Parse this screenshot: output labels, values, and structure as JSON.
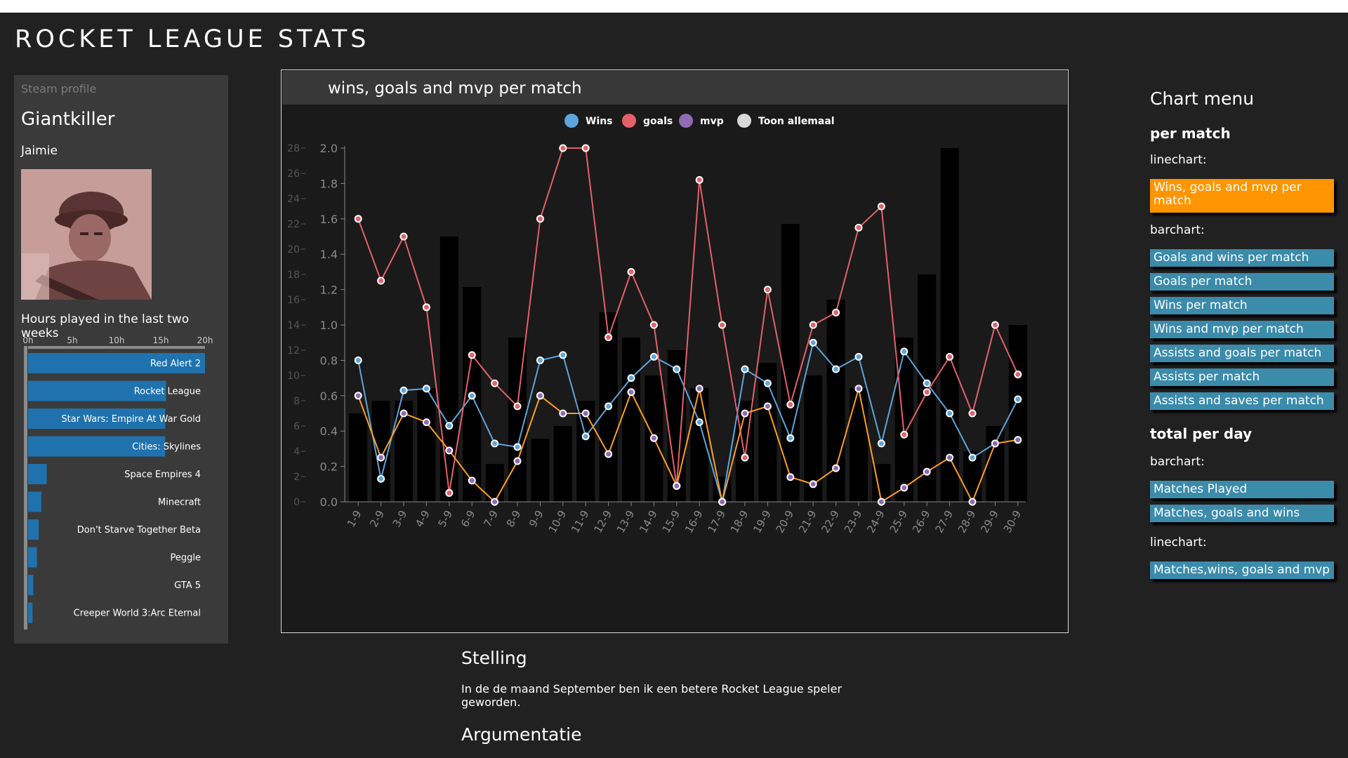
{
  "app": {
    "title": "ROCKET LEAGUE STATS"
  },
  "profile": {
    "section_label": "Steam profile",
    "username": "Giantkiller",
    "real_name": "Jaimie",
    "hours_title": "Hours played in the last two weeks",
    "hours_ticks": [
      "0h",
      "5h",
      "10h",
      "15h",
      "20h"
    ],
    "hours_max": 20,
    "games": [
      {
        "name": "Red Alert 2",
        "hours": 20
      },
      {
        "name": "Rocket League",
        "hours": 15.6
      },
      {
        "name": "Star Wars: Empire At War Gold",
        "hours": 15.5
      },
      {
        "name": "Cities: Skylines",
        "hours": 15.5
      },
      {
        "name": "Space Empires 4",
        "hours": 2.1
      },
      {
        "name": "Minecraft",
        "hours": 1.5
      },
      {
        "name": "Don't Starve Together Beta",
        "hours": 1.2
      },
      {
        "name": "Peggle",
        "hours": 1.0
      },
      {
        "name": "GTA 5",
        "hours": 0.6
      },
      {
        "name": "Creeper World 3:Arc Eternal",
        "hours": 0.5
      }
    ]
  },
  "main_chart": {
    "title": "wins, goals and mvp per match",
    "legend": [
      {
        "label": "Wins",
        "color": "#5da5da"
      },
      {
        "label": "goals",
        "color": "#e5606a"
      },
      {
        "label": "mvp",
        "color": "#8e6bb3"
      },
      {
        "label": "Toon allemaal",
        "color": "#d8d8d8"
      }
    ]
  },
  "chart_data": {
    "type": "line",
    "title": "wins, goals and mvp per match",
    "x": [
      "1-9",
      "2-9",
      "3-9",
      "4-9",
      "5-9",
      "6-9",
      "7-9",
      "8-9",
      "9-9",
      "10-9",
      "11-9",
      "12-9",
      "13-9",
      "14-9",
      "15-9",
      "16-9",
      "17-9",
      "18-9",
      "19-9",
      "20-9",
      "21-9",
      "22-9",
      "23-9",
      "24-9",
      "25-9",
      "26-9",
      "27-9",
      "28-9",
      "29-9",
      "30-9"
    ],
    "y_left": {
      "ticks": [
        0,
        2,
        4,
        6,
        8,
        10,
        12,
        14,
        16,
        18,
        20,
        22,
        24,
        26,
        28
      ],
      "ylim": [
        0,
        28
      ]
    },
    "y_right": {
      "ticks": [
        "0.0",
        "0.2",
        "0.4",
        "0.6",
        "0.8",
        "1.0",
        "1.2",
        "1.4",
        "1.6",
        "1.8",
        "2.0"
      ],
      "ylim": [
        0,
        2.0
      ]
    },
    "bars": [
      7,
      8,
      8,
      9,
      21,
      17,
      3,
      13,
      5,
      6,
      8,
      15,
      13,
      10,
      12,
      9,
      2,
      8,
      11,
      22,
      10,
      16,
      9,
      3,
      13,
      18,
      28,
      4,
      6,
      14
    ],
    "series": [
      {
        "name": "Wins",
        "color": "#5da5da",
        "values": [
          0.8,
          0.13,
          0.63,
          0.64,
          0.43,
          0.6,
          0.33,
          0.31,
          0.8,
          0.83,
          0.37,
          0.54,
          0.7,
          0.82,
          0.75,
          0.45,
          0,
          0.75,
          0.67,
          0.36,
          0.9,
          0.75,
          0.82,
          0.33,
          0.85,
          0.67,
          0.5,
          0.25,
          0.33,
          0.58
        ]
      },
      {
        "name": "goals",
        "color": "#e5606a",
        "values": [
          1.6,
          1.25,
          1.5,
          1.1,
          0.05,
          0.83,
          0.67,
          0.54,
          1.6,
          2.0,
          2.0,
          0.93,
          1.3,
          1.0,
          0.09,
          1.82,
          1.0,
          0.25,
          1.2,
          0.55,
          1.0,
          1.07,
          1.55,
          1.67,
          0.38,
          0.62,
          0.82,
          0.5,
          1.0,
          0.72
        ]
      },
      {
        "name": "mvp",
        "color": "#8e6bb3",
        "line_color": "#ff9f1c",
        "values": [
          0.6,
          0.25,
          0.5,
          0.45,
          0.29,
          0.12,
          0,
          0.23,
          0.6,
          0.5,
          0.5,
          0.27,
          0.62,
          0.36,
          0.09,
          0.64,
          0,
          0.5,
          0.54,
          0.14,
          0.1,
          0.19,
          0.64,
          0,
          0.08,
          0.17,
          0.25,
          0,
          0.33,
          0.35
        ]
      }
    ]
  },
  "stelling": {
    "title": "Stelling",
    "text": "In de de maand September ben ik een betere Rocket League speler geworden.",
    "argument_title": "Argumentatie"
  },
  "menu": {
    "title": "Chart menu",
    "per_match_label": "per match",
    "linechart_label": "linechart:",
    "barchart_label": "barchart:",
    "active_item": "Wins, goals and mvp per match",
    "barchart_items": [
      "Goals and wins per match",
      "Goals per match",
      "Wins per match",
      "Wins and mvp per match",
      "Assists and goals per match",
      "Assists per match",
      "Assists and saves per match"
    ],
    "total_label": "total per day",
    "total_barchart_label": "barchart:",
    "total_barchart_items": [
      "Matches Played",
      "Matches, goals and wins"
    ],
    "total_linechart_label": "linechart:",
    "total_linechart_items": [
      "Matches,wins, goals and mvp"
    ]
  }
}
